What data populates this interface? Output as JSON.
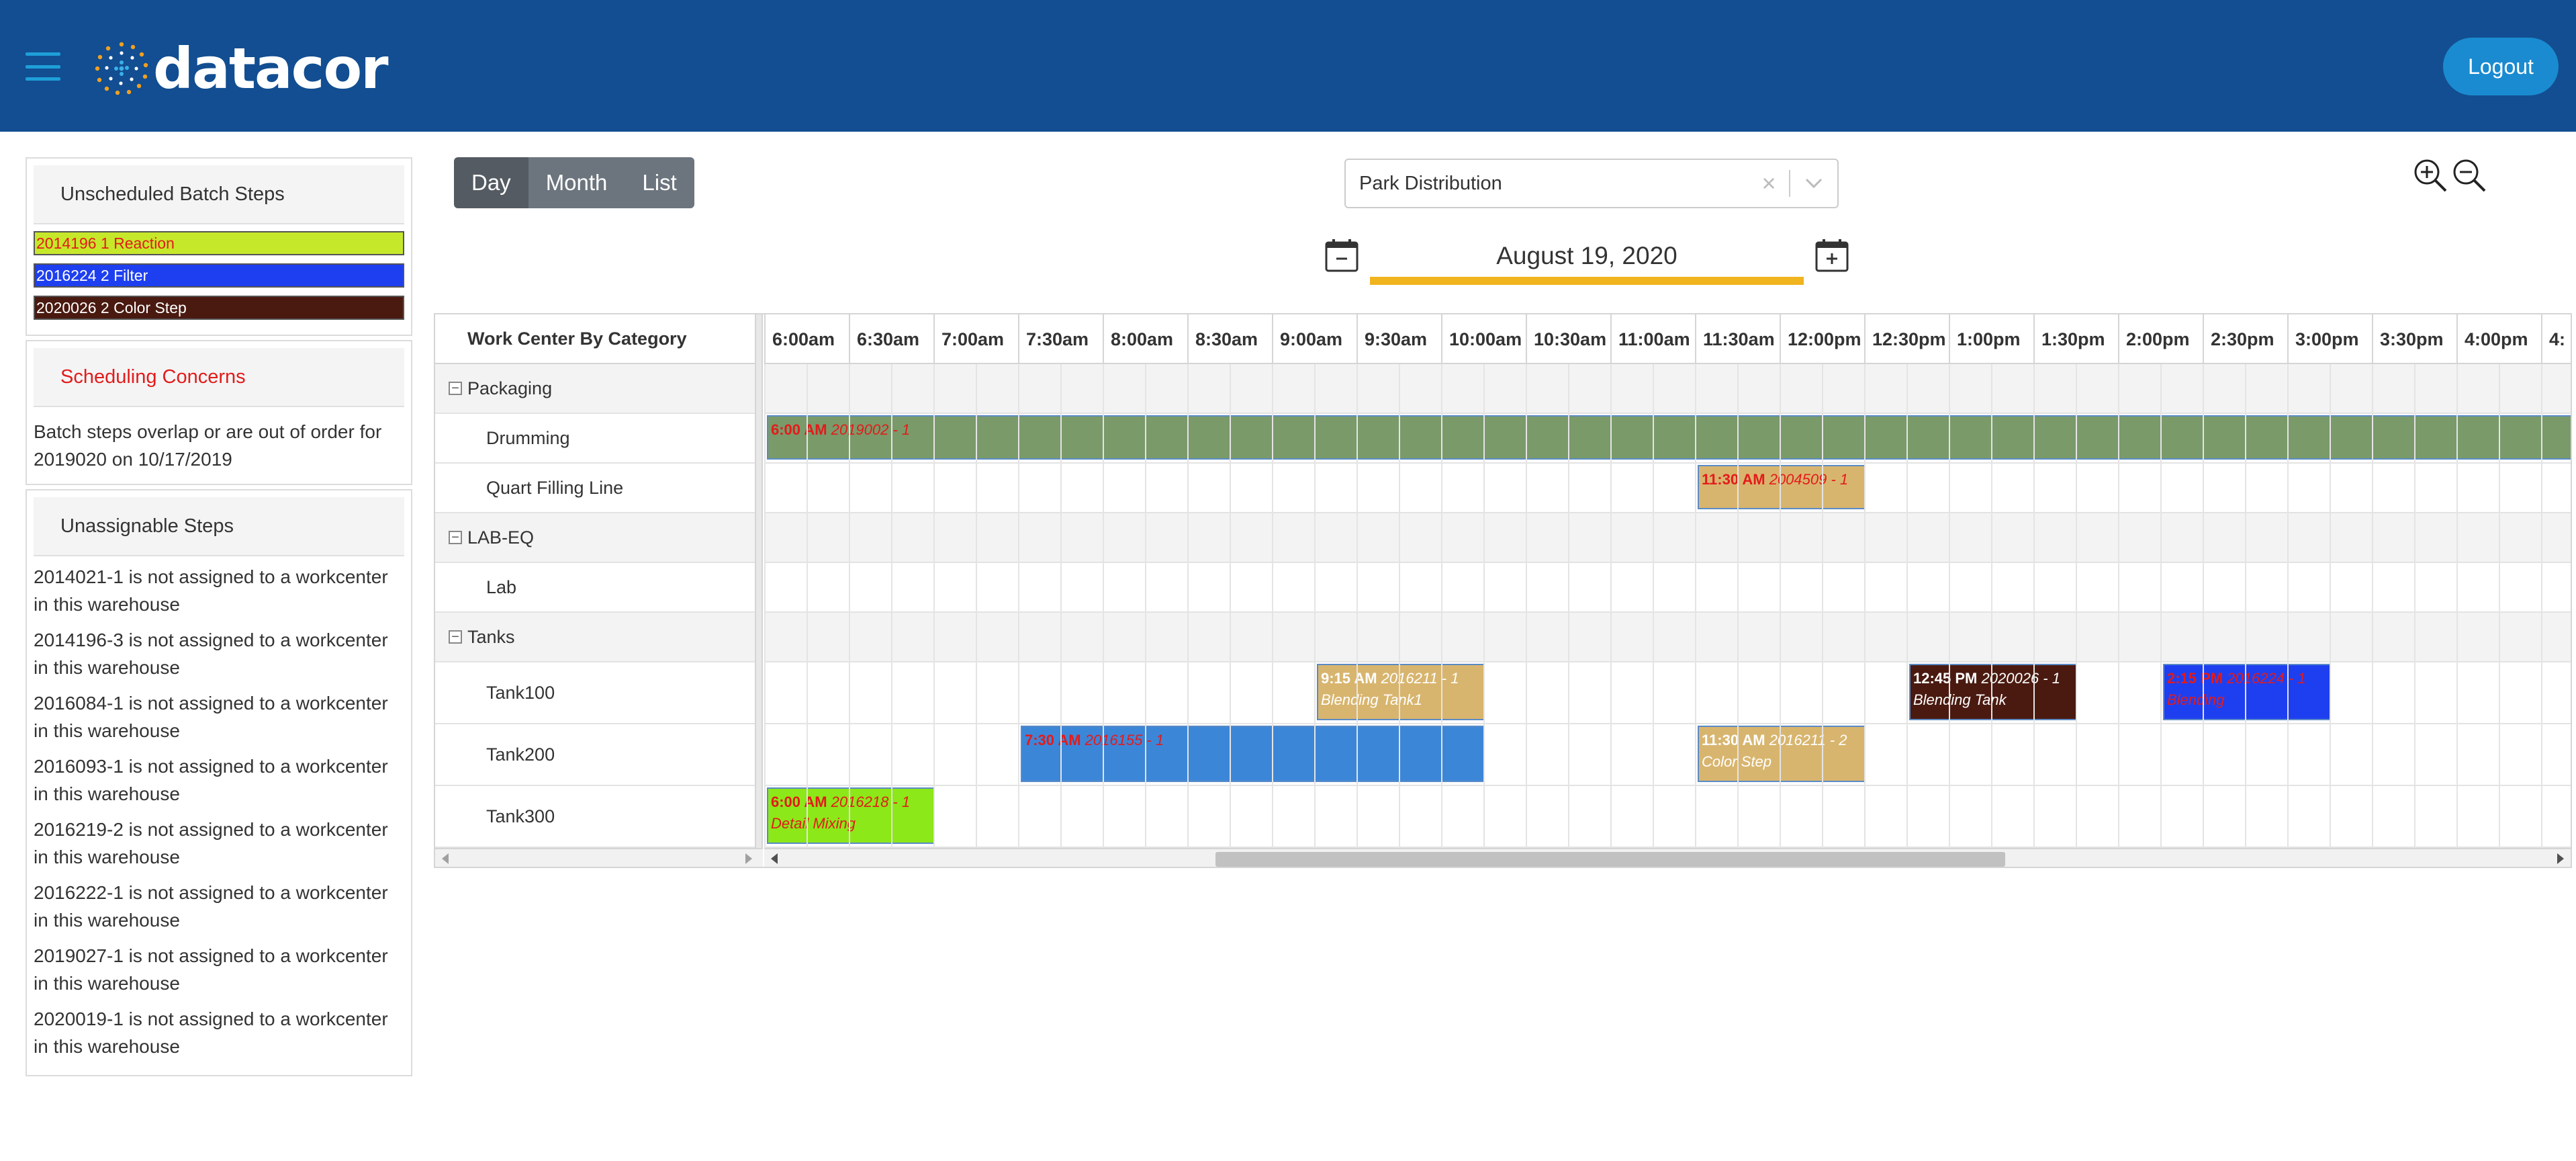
{
  "header": {
    "logo_text": "datacor",
    "logout_label": "Logout"
  },
  "sidebar": {
    "unscheduled_title": "Unscheduled Batch Steps",
    "batches": [
      {
        "label": "2014196 1 Reaction",
        "bg": "#c6e82a",
        "fg": "#e31b1b"
      },
      {
        "label": "2016224 2 Filter",
        "bg": "#1e3ff0",
        "fg": "#ffffff"
      },
      {
        "label": "2020026 2 Color Step",
        "bg": "#4a1a10",
        "fg": "#ffffff"
      }
    ],
    "concerns_title": "Scheduling Concerns",
    "concerns_text": "Batch steps overlap or are out of order for 2019020 on 10/17/2019",
    "unassignable_title": "Unassignable Steps",
    "unassignable": [
      "2014021-1 is not assigned to a workcenter in this warehouse",
      "2014196-3 is not assigned to a workcenter in this warehouse",
      "2016084-1 is not assigned to a workcenter in this warehouse",
      "2016093-1 is not assigned to a workcenter in this warehouse",
      "2016219-2 is not assigned to a workcenter in this warehouse",
      "2016222-1 is not assigned to a workcenter in this warehouse",
      "2019027-1 is not assigned to a workcenter in this warehouse",
      "2020019-1 is not assigned to a workcenter in this warehouse"
    ]
  },
  "toolbar": {
    "views": [
      "Day",
      "Month",
      "List"
    ],
    "active_view": "Day",
    "warehouse": "Park Distribution",
    "date": "August 19, 2020"
  },
  "scheduler": {
    "resource_header": "Work Center By Category",
    "times": [
      "6:00am",
      "6:30am",
      "7:00am",
      "7:30am",
      "8:00am",
      "8:30am",
      "9:00am",
      "9:30am",
      "10:00am",
      "10:30am",
      "11:00am",
      "11:30am",
      "12:00pm",
      "12:30pm",
      "1:00pm",
      "1:30pm",
      "2:00pm",
      "2:30pm",
      "3:00pm",
      "3:30pm",
      "4:00pm",
      "4:"
    ],
    "categories": [
      "Packaging",
      "LAB-EQ",
      "Tanks"
    ],
    "resources": {
      "drumming": "Drumming",
      "quart": "Quart Filling Line",
      "lab": "Lab",
      "tank100": "Tank100",
      "tank200": "Tank200",
      "tank300": "Tank300"
    },
    "events": [
      {
        "row": 1,
        "start": 0,
        "span": 22,
        "time": "6:00 AM",
        "code": "2019002 - 1",
        "desc": "",
        "bg": "#7a9a6a",
        "fg": "#e31b1b",
        "descColor": "#e31b1b"
      },
      {
        "row": 2,
        "start": 11,
        "span": 2,
        "time": "11:30 AM",
        "code": "2004509 - 1",
        "desc": "",
        "bg": "#d8b56e",
        "fg": "#e31b1b",
        "descColor": "#e31b1b"
      },
      {
        "row": 6,
        "start": 6.5,
        "span": 2,
        "time": "9:15 AM",
        "code": "2016211 - 1",
        "desc": "Blending Tank1",
        "bg": "#d8b56e",
        "fg": "#ffffff",
        "descColor": "#ffffff"
      },
      {
        "row": 6,
        "start": 13.5,
        "span": 2,
        "time": "12:45 PM",
        "code": "2020026 - 1",
        "desc": "Blending Tank",
        "bg": "#4a1a10",
        "fg": "#ffffff",
        "descColor": "#ffffff"
      },
      {
        "row": 6,
        "start": 16.5,
        "span": 2,
        "time": "2:15 PM",
        "code": "2016224 - 1",
        "desc": "Blending",
        "bg": "#1e3ff0",
        "fg": "#e31b1b",
        "descColor": "#e31b1b"
      },
      {
        "row": 7,
        "start": 3,
        "span": 5.5,
        "time": "7:30 AM",
        "code": "2016155 - 1",
        "desc": "",
        "bg": "#3c86d8",
        "fg": "#e31b1b",
        "descColor": "#e31b1b"
      },
      {
        "row": 7,
        "start": 11,
        "span": 2,
        "time": "11:30 AM",
        "code": "2016211 - 2",
        "desc": "Color Step",
        "bg": "#d8b56e",
        "fg": "#ffffff",
        "descColor": "#ffffff"
      },
      {
        "row": 8,
        "start": 0,
        "span": 2,
        "time": "6:00 AM",
        "code": "2016218 - 1",
        "desc": "Detail Mixing",
        "bg": "#8ce818",
        "fg": "#e31b1b",
        "descColor": "#e31b1b"
      }
    ]
  }
}
